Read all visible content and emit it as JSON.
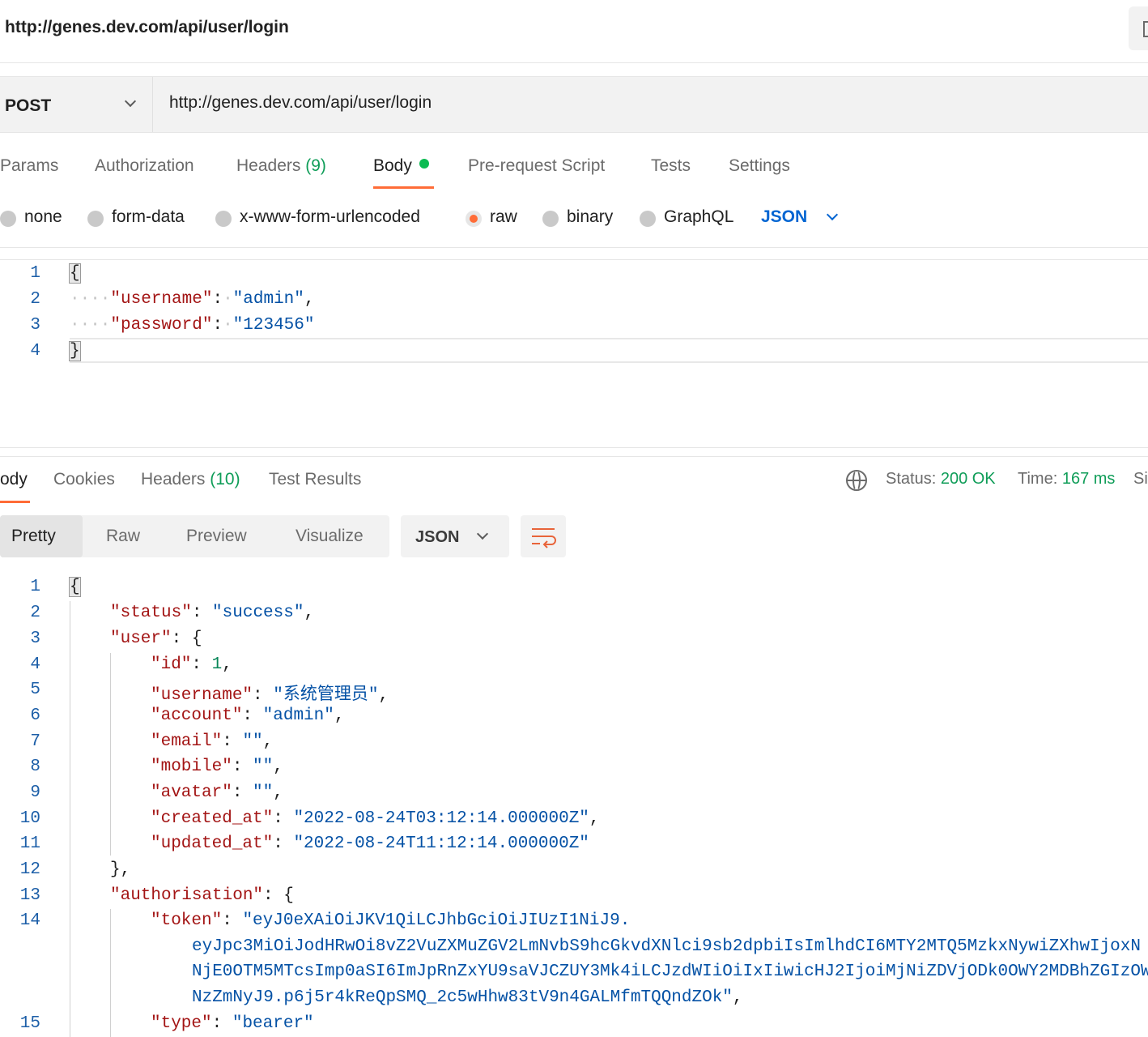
{
  "title": "http://genes.dev.com/api/user/login",
  "request": {
    "method": "POST",
    "url": "http://genes.dev.com/api/user/login"
  },
  "request_tabs": [
    {
      "label": "Params"
    },
    {
      "label": "Authorization"
    },
    {
      "label": "Headers",
      "count": "(9)"
    },
    {
      "label": "Body",
      "active": true
    },
    {
      "label": "Pre-request Script"
    },
    {
      "label": "Tests"
    },
    {
      "label": "Settings"
    }
  ],
  "body_types": {
    "options": [
      "none",
      "form-data",
      "x-www-form-urlencoded",
      "raw",
      "binary",
      "GraphQL"
    ],
    "selected": "raw",
    "language": "JSON"
  },
  "request_body": {
    "line_numbers": [
      "1",
      "2",
      "3",
      "4"
    ],
    "open_brace": "{",
    "close_brace": "}",
    "lines": [
      {
        "key": "\"username\"",
        "value": "\"admin\"",
        "trail": ","
      },
      {
        "key": "\"password\"",
        "value": "\"123456\"",
        "trail": ""
      }
    ]
  },
  "response_tabs": [
    {
      "label": "ody",
      "active": true
    },
    {
      "label": "Cookies"
    },
    {
      "label": "Headers",
      "count": "(10)"
    },
    {
      "label": "Test Results"
    }
  ],
  "response_status": {
    "status_label": "Status:",
    "status_value": "200 OK",
    "time_label": "Time:",
    "time_value": "167 ms",
    "size_label": "Si"
  },
  "view_modes": [
    "Pretty",
    "Raw",
    "Preview",
    "Visualize"
  ],
  "active_view": "Pretty",
  "format": "JSON",
  "response_body": {
    "line_numbers": [
      "1",
      "2",
      "3",
      "4",
      "5",
      "6",
      "7",
      "8",
      "9",
      "10",
      "11",
      "12",
      "13",
      "14",
      "15"
    ],
    "l1": "{",
    "status_key": "\"status\"",
    "status_val": "\"success\"",
    "user_key": "\"user\"",
    "id_key": "\"id\"",
    "id_val": "1",
    "username_key": "\"username\"",
    "username_val": "\"系统管理员\"",
    "account_key": "\"account\"",
    "account_val": "\"admin\"",
    "email_key": "\"email\"",
    "email_val": "\"\"",
    "mobile_key": "\"mobile\"",
    "mobile_val": "\"\"",
    "avatar_key": "\"avatar\"",
    "avatar_val": "\"\"",
    "created_key": "\"created_at\"",
    "created_val": "\"2022-08-24T03:12:14.000000Z\"",
    "updated_key": "\"updated_at\"",
    "updated_val": "\"2022-08-24T11:12:14.000000Z\"",
    "close_user": "},",
    "auth_key": "\"authorisation\"",
    "token_key": "\"token\"",
    "token_part1": "\"eyJ0eXAiOiJKV1QiLCJhbGciOiJIUzI1NiJ9.",
    "token_part2": "eyJpc3MiOiJodHRwOi8vZ2VuZXMuZGV2LmNvbS9hcGkvdXNlci9sb2dpbiIsImlhdCI6MTY2MTQ5MzkxNywiZXhwIjoxN",
    "token_part3": "NjE0OTM5MTcsImp0aSI6ImJpRnZxYU9saVJCZUY3Mk4iLCJzdWIiOiIxIiwicHJ2IjoiMjNiZDVjODk0OWY2MDBhZGIzOW",
    "token_part4": "NzZmNyJ9.p6j5r4kReQpSMQ_2c5wHhw83tV9n4GALMfmTQQndZOk\"",
    "type_key": "\"type\"",
    "type_val": "\"bearer\""
  }
}
